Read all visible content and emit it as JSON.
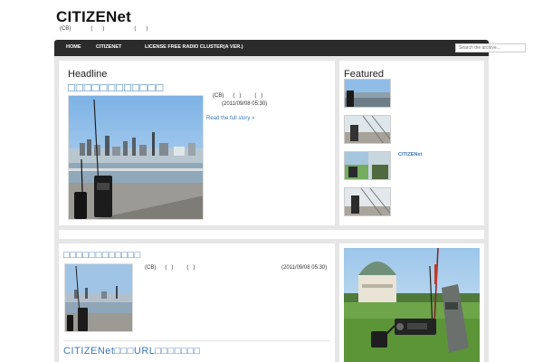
{
  "site": {
    "title": "CITIZENet",
    "tagline": "(CB)      (   )         (   )"
  },
  "nav": {
    "items": [
      "HOME",
      "CITIZENET",
      "LICENSE FREE RADIO CLUSTER(A VER.)"
    ],
    "search_placeholder": "Search the archive..."
  },
  "headline": {
    "label": "Headline",
    "title": "□□□□□□□□□□□□",
    "meta_line1": "(CB)      (   )         (   )",
    "meta_line2": "(2011/09/08 05:30)",
    "read_more": "Read the full story »"
  },
  "featured": {
    "label": "Featured",
    "caption": "CITIZENet"
  },
  "posts": [
    {
      "title": "□□□□□□□□□□□□",
      "meta": "(CB)      (   )         (   )",
      "date": "(2011/09/08 05:30)"
    },
    {
      "title": "CITIZENet□□□URL□□□□□□□"
    }
  ],
  "colors": {
    "link": "#3a78b5",
    "nav_bg": "#2b2b2b",
    "frame_bg": "#e6e6e6"
  }
}
